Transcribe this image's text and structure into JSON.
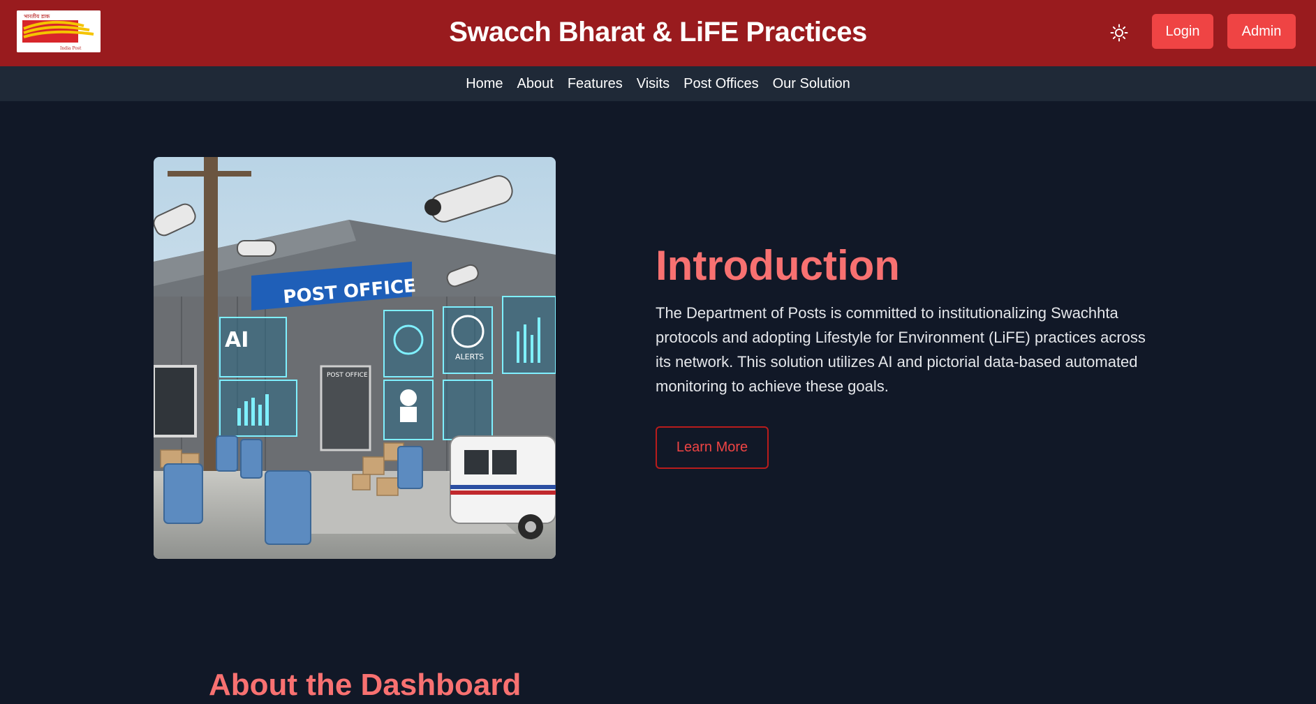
{
  "header": {
    "logo": {
      "icon": "india-post-logo-icon",
      "caption_top": "भारतीय डाक",
      "caption_bottom": "India Post"
    },
    "title": "Swacch Bharat & LiFE Practices",
    "theme_toggle_icon": "sun-icon",
    "login_label": "Login",
    "admin_label": "Admin"
  },
  "nav": {
    "items": [
      {
        "label": "Home"
      },
      {
        "label": "About"
      },
      {
        "label": "Features"
      },
      {
        "label": "Visits"
      },
      {
        "label": "Post Offices"
      },
      {
        "label": "Our Solution"
      }
    ]
  },
  "hero": {
    "image_texts": {
      "post_office": "POST OFFICE",
      "ai": "AI",
      "alerts": "ALERTS",
      "door_sign": "POST OFFICE"
    },
    "heading": "Introduction",
    "text": "The Department of Posts is committed to institutionalizing Swachhta protocols and adopting Lifestyle for Environment (LiFE) practices across its network. This solution utilizes AI and pictorial data-based automated monitoring to achieve these goals.",
    "button_label": "Learn More"
  },
  "about": {
    "heading": "About the Dashboard"
  },
  "colors": {
    "header_bg": "#991b1e",
    "nav_bg": "#1f2937",
    "page_bg": "#111827",
    "accent": "#ef4444",
    "heading": "#f87171"
  }
}
